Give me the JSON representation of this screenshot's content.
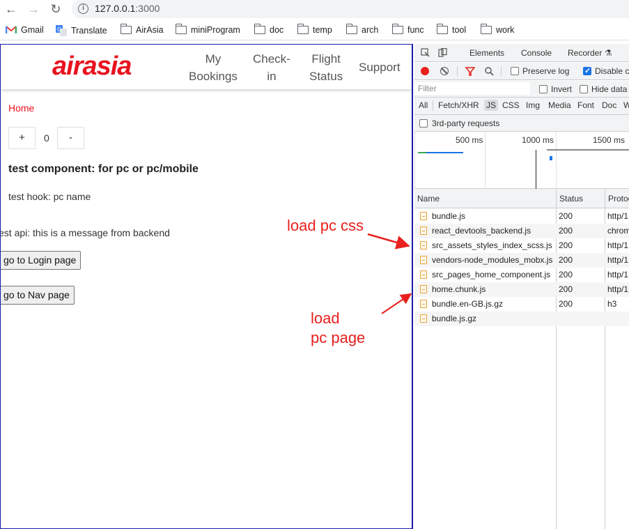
{
  "browser": {
    "url_host": "127.0.0.1",
    "url_port": ":3000",
    "bookmarks": [
      {
        "label": "Gmail",
        "icon": "gmail-icon"
      },
      {
        "label": "Translate",
        "icon": "google-translate-icon"
      },
      {
        "label": "AirAsia",
        "icon": "folder-icon"
      },
      {
        "label": "miniProgram",
        "icon": "folder-icon"
      },
      {
        "label": "doc",
        "icon": "folder-icon"
      },
      {
        "label": "temp",
        "icon": "folder-icon"
      },
      {
        "label": "arch",
        "icon": "folder-icon"
      },
      {
        "label": "func",
        "icon": "folder-icon"
      },
      {
        "label": "tool",
        "icon": "folder-icon"
      },
      {
        "label": "work",
        "icon": "folder-icon"
      }
    ]
  },
  "site": {
    "logo": "airasia",
    "nav": [
      {
        "line1": "My",
        "line2": "Bookings"
      },
      {
        "line1": "Check-",
        "line2": "in"
      },
      {
        "line1": "Flight",
        "line2": "Status"
      },
      {
        "line1": "Support",
        "line2": ""
      }
    ],
    "breadcrumb": "Home",
    "counter": {
      "plus": "+",
      "value": "0",
      "minus": "-"
    },
    "component_title": "test component: for pc or pc/mobile",
    "hook_text": "test hook: pc name",
    "api_text": "est api: this is a message from backend",
    "login_button": "go to Login page",
    "nav_button": "go to Nav page"
  },
  "annotations": {
    "css": "load pc css",
    "page": "load\npc page",
    "color": "#e8201e"
  },
  "devtools": {
    "tabs": [
      "Elements",
      "Console",
      "Recorder"
    ],
    "preserve_log": "Preserve log",
    "disable_cache": "Disable c",
    "filter_placeholder": "Filter",
    "invert": "Invert",
    "hide_data": "Hide data",
    "types": [
      "All",
      "Fetch/XHR",
      "JS",
      "CSS",
      "Img",
      "Media",
      "Font",
      "Doc",
      "W"
    ],
    "active_type": "JS",
    "third_party": "3rd-party requests",
    "timeline_labels": [
      "500 ms",
      "1000 ms",
      "1500 ms"
    ],
    "columns": [
      "Name",
      "Status",
      "Protoc"
    ],
    "rows": [
      {
        "name": "bundle.js",
        "status": "200",
        "protocol": "http/1"
      },
      {
        "name": "react_devtools_backend.js",
        "status": "200",
        "protocol": "chrom"
      },
      {
        "name": "src_assets_styles_index_scss.js",
        "status": "200",
        "protocol": "http/1"
      },
      {
        "name": "vendors-node_modules_mobx.js",
        "status": "200",
        "protocol": "http/1"
      },
      {
        "name": "src_pages_home_component.js",
        "status": "200",
        "protocol": "http/1"
      },
      {
        "name": "home.chunk.js",
        "status": "200",
        "protocol": "http/1"
      },
      {
        "name": "bundle.en-GB.js.gz",
        "status": "200",
        "protocol": "h3"
      },
      {
        "name": "bundle.js.gz",
        "status": "",
        "protocol": ""
      }
    ]
  }
}
